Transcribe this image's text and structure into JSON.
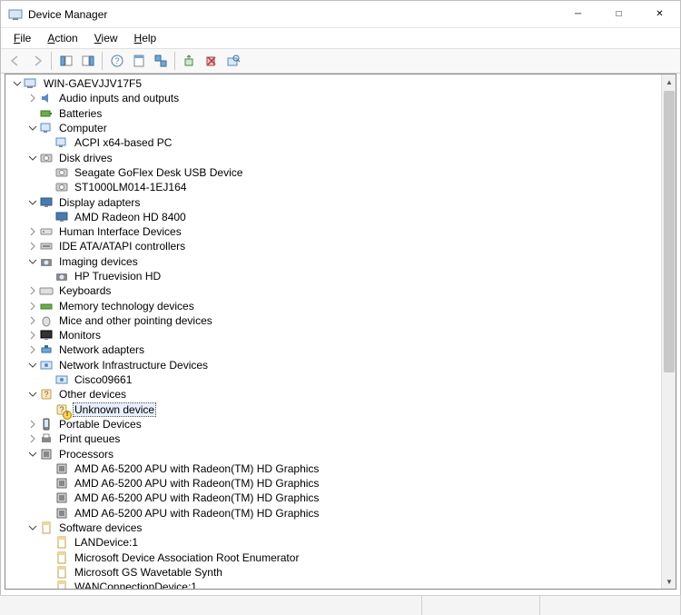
{
  "window": {
    "title": "Device Manager"
  },
  "menubar": {
    "file": "File",
    "action": "Action",
    "view": "View",
    "help": "Help"
  },
  "toolbar": {
    "back": "Back",
    "forward": "Forward",
    "show_hide_tree": "Show/Hide Console Tree",
    "show_hide_action": "Show/Hide Action Pane",
    "help": "Help",
    "properties": "Properties",
    "update": "Update Driver",
    "uninstall": "Uninstall Device",
    "scan": "Scan for hardware changes",
    "add_legacy": "Add legacy hardware"
  },
  "tree": {
    "root": {
      "label": "WIN-GAEVJJV17F5",
      "expanded": true,
      "icon": "computer",
      "depth": 0
    },
    "nodes": [
      {
        "label": "Audio inputs and outputs",
        "expanded": false,
        "arrow": "closed",
        "icon": "audio",
        "depth": 1
      },
      {
        "label": "Batteries",
        "expanded": false,
        "arrow": "none",
        "icon": "battery",
        "depth": 1
      },
      {
        "label": "Computer",
        "expanded": true,
        "arrow": "open",
        "icon": "computer-cat",
        "depth": 1
      },
      {
        "label": "ACPI x64-based PC",
        "expanded": false,
        "arrow": "none",
        "icon": "computer-cat",
        "depth": 2
      },
      {
        "label": "Disk drives",
        "expanded": true,
        "arrow": "open",
        "icon": "disk",
        "depth": 1
      },
      {
        "label": "Seagate GoFlex Desk USB Device",
        "expanded": false,
        "arrow": "none",
        "icon": "disk",
        "depth": 2
      },
      {
        "label": "ST1000LM014-1EJ164",
        "expanded": false,
        "arrow": "none",
        "icon": "disk",
        "depth": 2
      },
      {
        "label": "Display adapters",
        "expanded": true,
        "arrow": "open",
        "icon": "display",
        "depth": 1
      },
      {
        "label": "AMD Radeon HD 8400",
        "expanded": false,
        "arrow": "none",
        "icon": "display",
        "depth": 2
      },
      {
        "label": "Human Interface Devices",
        "expanded": false,
        "arrow": "closed",
        "icon": "hid",
        "depth": 1
      },
      {
        "label": "IDE ATA/ATAPI controllers",
        "expanded": false,
        "arrow": "closed",
        "icon": "ide",
        "depth": 1
      },
      {
        "label": "Imaging devices",
        "expanded": true,
        "arrow": "open",
        "icon": "imaging",
        "depth": 1
      },
      {
        "label": "HP Truevision HD",
        "expanded": false,
        "arrow": "none",
        "icon": "imaging",
        "depth": 2
      },
      {
        "label": "Keyboards",
        "expanded": false,
        "arrow": "closed",
        "icon": "keyboard",
        "depth": 1
      },
      {
        "label": "Memory technology devices",
        "expanded": false,
        "arrow": "closed",
        "icon": "memory",
        "depth": 1
      },
      {
        "label": "Mice and other pointing devices",
        "expanded": false,
        "arrow": "closed",
        "icon": "mouse",
        "depth": 1
      },
      {
        "label": "Monitors",
        "expanded": false,
        "arrow": "closed",
        "icon": "monitor",
        "depth": 1
      },
      {
        "label": "Network adapters",
        "expanded": false,
        "arrow": "closed",
        "icon": "network",
        "depth": 1
      },
      {
        "label": "Network Infrastructure Devices",
        "expanded": true,
        "arrow": "open",
        "icon": "netinfra",
        "depth": 1
      },
      {
        "label": "Cisco09661",
        "expanded": false,
        "arrow": "none",
        "icon": "netinfra",
        "depth": 2
      },
      {
        "label": "Other devices",
        "expanded": true,
        "arrow": "open",
        "icon": "other",
        "depth": 1
      },
      {
        "label": "Unknown device",
        "expanded": false,
        "arrow": "none",
        "icon": "other-warn",
        "depth": 2,
        "selected": true
      },
      {
        "label": "Portable Devices",
        "expanded": false,
        "arrow": "closed",
        "icon": "portable",
        "depth": 1
      },
      {
        "label": "Print queues",
        "expanded": false,
        "arrow": "closed",
        "icon": "printer",
        "depth": 1
      },
      {
        "label": "Processors",
        "expanded": true,
        "arrow": "open",
        "icon": "cpu",
        "depth": 1
      },
      {
        "label": "AMD A6-5200 APU with Radeon(TM) HD Graphics",
        "expanded": false,
        "arrow": "none",
        "icon": "cpu",
        "depth": 2
      },
      {
        "label": "AMD A6-5200 APU with Radeon(TM) HD Graphics",
        "expanded": false,
        "arrow": "none",
        "icon": "cpu",
        "depth": 2
      },
      {
        "label": "AMD A6-5200 APU with Radeon(TM) HD Graphics",
        "expanded": false,
        "arrow": "none",
        "icon": "cpu",
        "depth": 2
      },
      {
        "label": "AMD A6-5200 APU with Radeon(TM) HD Graphics",
        "expanded": false,
        "arrow": "none",
        "icon": "cpu",
        "depth": 2
      },
      {
        "label": "Software devices",
        "expanded": true,
        "arrow": "open",
        "icon": "software",
        "depth": 1
      },
      {
        "label": "LANDevice:1",
        "expanded": false,
        "arrow": "none",
        "icon": "software",
        "depth": 2
      },
      {
        "label": "Microsoft Device Association Root Enumerator",
        "expanded": false,
        "arrow": "none",
        "icon": "software",
        "depth": 2
      },
      {
        "label": "Microsoft GS Wavetable Synth",
        "expanded": false,
        "arrow": "none",
        "icon": "software",
        "depth": 2
      },
      {
        "label": "WANConnectionDevice:1",
        "expanded": false,
        "arrow": "none",
        "icon": "software",
        "depth": 2
      }
    ]
  },
  "icons": {
    "computer": "🖥",
    "audio": "🔊",
    "battery": "🔋",
    "computer-cat": "🖥",
    "disk": "💽",
    "display": "🖵",
    "hid": "⌨",
    "ide": "🖴",
    "imaging": "📷",
    "keyboard": "⌨",
    "memory": "▭",
    "mouse": "🖱",
    "monitor": "🖵",
    "network": "🖧",
    "netinfra": "🖧",
    "other": "❓",
    "other-warn": "❓",
    "portable": "📱",
    "printer": "🖨",
    "cpu": "▣",
    "software": "📄"
  }
}
